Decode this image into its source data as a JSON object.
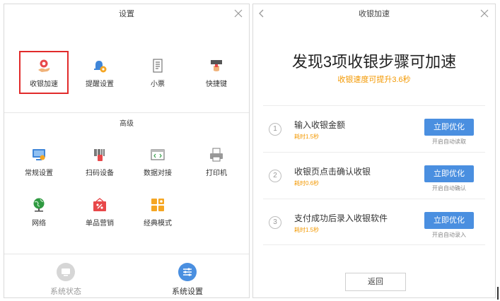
{
  "left": {
    "title": "设置",
    "top_items": [
      {
        "label": "收银加速",
        "icon": "cashier-speed-icon"
      },
      {
        "label": "提醒设置",
        "icon": "bell-settings-icon"
      },
      {
        "label": "小票",
        "icon": "receipt-icon"
      },
      {
        "label": "快捷键",
        "icon": "shortcut-key-icon"
      }
    ],
    "advanced_title": "高级",
    "advanced_items": [
      {
        "label": "常规设置",
        "icon": "monitor-settings-icon"
      },
      {
        "label": "扫码设备",
        "icon": "barcode-scanner-icon"
      },
      {
        "label": "数据对接",
        "icon": "code-window-icon"
      },
      {
        "label": "打印机",
        "icon": "printer-icon"
      },
      {
        "label": "网络",
        "icon": "globe-icon"
      },
      {
        "label": "单品营销",
        "icon": "product-marketing-icon"
      },
      {
        "label": "经典模式",
        "icon": "grid-mode-icon"
      }
    ],
    "nav": {
      "status_label": "系统状态",
      "settings_label": "系统设置"
    }
  },
  "right": {
    "title": "收银加速",
    "headline": "发现3项收银步骤可加速",
    "subline": "收银速度可提升3.6秒",
    "steps": [
      {
        "num": "1",
        "title": "输入收银金额",
        "time": "耗时1.5秒",
        "button": "立即优化",
        "note": "开启自动读取"
      },
      {
        "num": "2",
        "title": "收银页点击确认收银",
        "time": "耗时0.6秒",
        "button": "立即优化",
        "note": "开启自动确认"
      },
      {
        "num": "3",
        "title": "支付成功后录入收银软件",
        "time": "耗时1.5秒",
        "button": "立即优化",
        "note": "开启自动录入"
      }
    ],
    "return_label": "返回"
  },
  "colors": {
    "accent_blue": "#4a8fe0",
    "orange": "#f39800",
    "highlight_red": "#e12b2b"
  }
}
